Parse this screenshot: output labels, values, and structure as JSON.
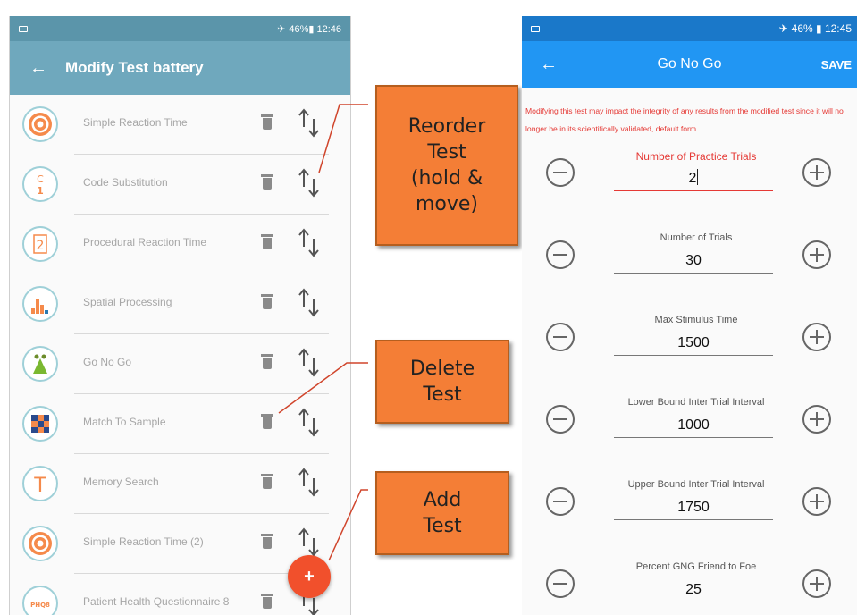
{
  "left_screen": {
    "status_bar": {
      "right_text": "46%▮ 12:46"
    },
    "app_bar": {
      "title": "Modify Test battery"
    },
    "tests": [
      {
        "name": "Simple Reaction Time",
        "icon": "target-icon"
      },
      {
        "name": "Code Substitution",
        "icon": "code-substitution-icon"
      },
      {
        "name": "Procedural Reaction Time",
        "icon": "procedural-icon"
      },
      {
        "name": "Spatial Processing",
        "icon": "bar-chart-icon"
      },
      {
        "name": "Go No Go",
        "icon": "figure-icon"
      },
      {
        "name": "Match To Sample",
        "icon": "grid-icon"
      },
      {
        "name": "Memory Search",
        "icon": "letter-t-icon"
      },
      {
        "name": "Simple Reaction Time (2)",
        "icon": "target-icon"
      },
      {
        "name": "Patient Health Questionnaire 8",
        "icon": "phq-icon"
      }
    ],
    "fab_label": "+"
  },
  "callouts": {
    "reorder": "Reorder\nTest\n(hold &\nmove)",
    "delete": "Delete\nTest",
    "add": "Add\nTest"
  },
  "right_screen": {
    "status_bar": {
      "right_text": "46% ▮ 12:45"
    },
    "app_bar": {
      "title": "Go No Go",
      "save_label": "SAVE"
    },
    "warning": "Modifying this test may impact the integrity of any results from the modified test since it will no longer be in its scientifically validated, default form.",
    "fields": [
      {
        "label": "Number of Practice Trials",
        "value": "2",
        "active": true
      },
      {
        "label": "Number of Trials",
        "value": "30",
        "active": false
      },
      {
        "label": "Max Stimulus Time",
        "value": "1500",
        "active": false
      },
      {
        "label": "Lower Bound Inter Trial Interval",
        "value": "1000",
        "active": false
      },
      {
        "label": "Upper Bound Inter Trial Interval",
        "value": "1750",
        "active": false
      },
      {
        "label": "Percent GNG Friend to Foe",
        "value": "25",
        "active": false
      }
    ]
  },
  "colors": {
    "left_appbar": "#6fa8bd",
    "left_statusbar": "#5b95aa",
    "right_appbar": "#2196f3",
    "right_statusbar": "#1a78c9",
    "accent_red": "#e53935",
    "fab": "#f1502c",
    "callout": "#f47e36"
  }
}
